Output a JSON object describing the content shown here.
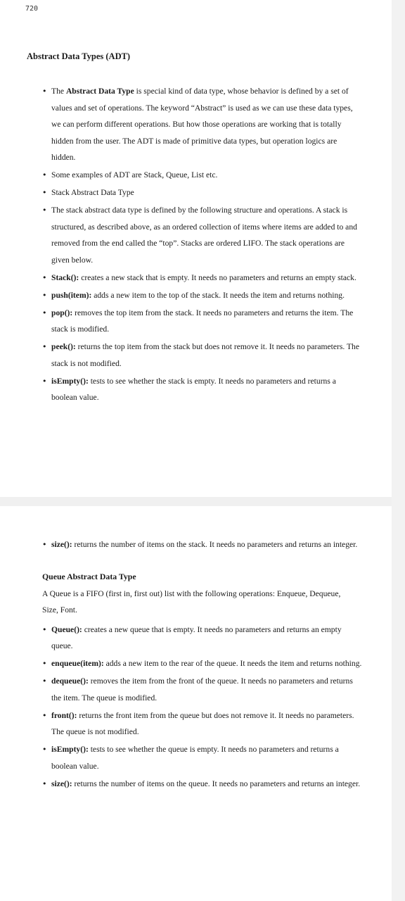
{
  "page_number": "720",
  "title": "Abstract Data Types (ADT)",
  "section1": {
    "items": [
      {
        "bold": "",
        "pre": "The ",
        "strong": "Abstract Data Type",
        "text": " is special kind of data type, whose behavior is defined by a set of values and set of operations. The keyword “Abstract” is used as we can use these data types, we can perform different operations. But how those operations are working that is totally hidden from the user. The ADT is made of primitive data types, but operation logics are hidden."
      },
      {
        "pre": "",
        "strong": "",
        "text": "Some examples of ADT are Stack, Queue, List etc."
      },
      {
        "pre": "",
        "strong": "",
        "text": "Stack Abstract Data Type"
      },
      {
        "pre": "",
        "strong": "",
        "text": "The stack abstract data type is defined by the following structure and operations. A stack is structured, as described above, as an ordered collection of items where items are added to and removed from the end called the “top”. Stacks are ordered LIFO. The stack operations are given below."
      },
      {
        "pre": "",
        "strong": "Stack():",
        "text": " creates a new stack that is empty. It needs no parameters and returns an empty stack."
      },
      {
        "pre": "",
        "strong": "push(item):",
        "text": " adds a new item to the top of the stack. It needs the item and returns nothing."
      },
      {
        "pre": "",
        "strong": "pop():",
        "text": " removes the top item from the stack. It needs no parameters and returns the item. The stack is modified."
      },
      {
        "pre": "",
        "strong": "peek():",
        "text": " returns the top item from the stack but does not remove it. It needs no parameters. The stack is not modified."
      },
      {
        "pre": "",
        "strong": "isEmpty():",
        "text": " tests to see whether the stack is empty. It needs no parameters and returns a boolean value."
      }
    ]
  },
  "section2": {
    "first_item": {
      "strong": "size():",
      "text": " returns the number of items on the stack. It needs no parameters and returns an integer."
    },
    "heading": "Queue Abstract Data Type",
    "paragraph": "A Queue is a FIFO (first in, first out) list with the following operations: Enqueue, Dequeue, Size, Font.",
    "items": [
      {
        "strong": "Queue():",
        "text": " creates a new queue that is empty. It needs no parameters and returns an empty queue."
      },
      {
        "strong": "enqueue(item):",
        "text": " adds a new item to the rear of the queue. It needs the item and returns nothing."
      },
      {
        "strong": "dequeue():",
        "text": " removes the item from the front of the queue. It needs no parameters and returns the item. The queue is modified."
      },
      {
        "strong": "front():",
        "text": " returns the front item from the queue but does not remove it. It needs no parameters. The queue is not modified."
      },
      {
        "strong": "isEmpty():",
        "text": " tests to see whether the queue is empty. It needs no parameters and returns a boolean value."
      },
      {
        "strong": "size():",
        "text": " returns the number of items on the queue. It needs no parameters and returns an integer."
      }
    ]
  }
}
